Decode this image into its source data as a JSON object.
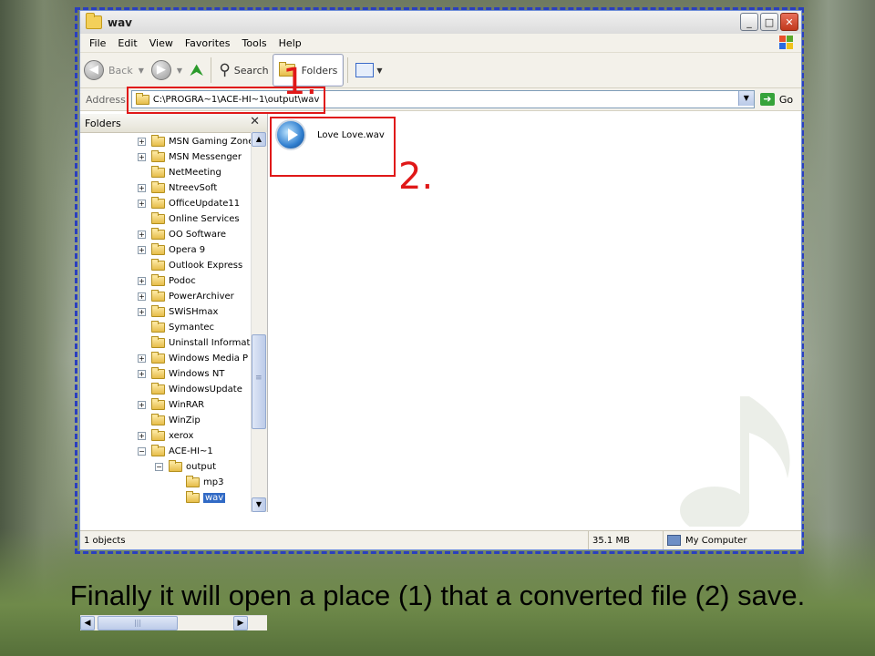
{
  "window": {
    "title": "wav"
  },
  "menu": [
    "File",
    "Edit",
    "View",
    "Favorites",
    "Tools",
    "Help"
  ],
  "toolbar": {
    "back_label": "Back",
    "search_label": "Search",
    "folders_label": "Folders"
  },
  "address": {
    "label": "Address",
    "value": "C:\\PROGRA~1\\ACE-HI~1\\output\\wav",
    "go_label": "Go"
  },
  "folders_pane": {
    "header": "Folders",
    "items": [
      {
        "label": "MSN Gaming Zone",
        "expander": "+",
        "selected": false
      },
      {
        "label": "MSN Messenger",
        "expander": "+",
        "selected": false
      },
      {
        "label": "NetMeeting",
        "expander": "",
        "selected": false
      },
      {
        "label": "NtreevSoft",
        "expander": "+",
        "selected": false
      },
      {
        "label": "OfficeUpdate11",
        "expander": "+",
        "selected": false
      },
      {
        "label": "Online Services",
        "expander": "",
        "selected": false
      },
      {
        "label": "OO Software",
        "expander": "+",
        "selected": false
      },
      {
        "label": "Opera 9",
        "expander": "+",
        "selected": false
      },
      {
        "label": "Outlook Express",
        "expander": "",
        "selected": false
      },
      {
        "label": "Podoc",
        "expander": "+",
        "selected": false
      },
      {
        "label": "PowerArchiver",
        "expander": "+",
        "selected": false
      },
      {
        "label": "SWiSHmax",
        "expander": "+",
        "selected": false
      },
      {
        "label": "Symantec",
        "expander": "",
        "selected": false
      },
      {
        "label": "Uninstall Informat",
        "expander": "",
        "selected": false
      },
      {
        "label": "Windows Media P",
        "expander": "+",
        "selected": false
      },
      {
        "label": "Windows NT",
        "expander": "+",
        "selected": false
      },
      {
        "label": "WindowsUpdate",
        "expander": "",
        "selected": false
      },
      {
        "label": "WinRAR",
        "expander": "+",
        "selected": false
      },
      {
        "label": "WinZip",
        "expander": "",
        "selected": false
      },
      {
        "label": "xerox",
        "expander": "+",
        "selected": false
      },
      {
        "label": "ACE-HI~1",
        "expander": "−",
        "selected": false
      },
      {
        "label": "output",
        "expander": "−",
        "selected": false,
        "level": 1
      },
      {
        "label": "mp3",
        "expander": "",
        "selected": false,
        "level": 2
      },
      {
        "label": "wav",
        "expander": "",
        "selected": true,
        "level": 2
      }
    ]
  },
  "files": [
    {
      "name": "Love Love.wav",
      "icon": "windows-media-player-icon"
    }
  ],
  "status": {
    "objects": "1 objects",
    "size": "35.1 MB",
    "location": "My Computer"
  },
  "annotations": {
    "one": "1.",
    "two": "2."
  },
  "caption": "Finally it will open a place (1) that a converted file (2) save.",
  "colors": {
    "annotation_red": "#e01818",
    "frame_dash": "#2a3fbf",
    "selection": "#316ac5"
  }
}
